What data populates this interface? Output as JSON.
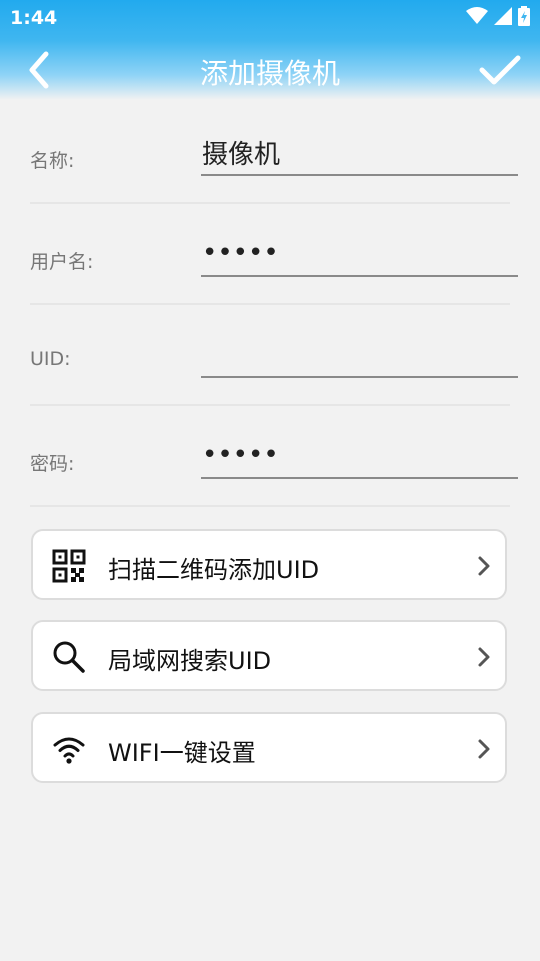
{
  "status_bar": {
    "time": "1:44"
  },
  "header": {
    "title": "添加摄像机"
  },
  "form": {
    "name": {
      "label": "名称:",
      "value": "摄像机"
    },
    "username": {
      "label": "用户名:",
      "value": "•••••"
    },
    "uid": {
      "label": "UID:",
      "value": ""
    },
    "password": {
      "label": "密码:",
      "value": "•••••"
    }
  },
  "actions": [
    {
      "label": "扫描二维码添加UID",
      "icon": "qr-code-icon"
    },
    {
      "label": "局域网搜索UID",
      "icon": "search-icon"
    },
    {
      "label": "WIFI一键设置",
      "icon": "wifi-icon"
    }
  ],
  "colors": {
    "header_blue": "#22aaee",
    "background": "#f2f2f2"
  }
}
